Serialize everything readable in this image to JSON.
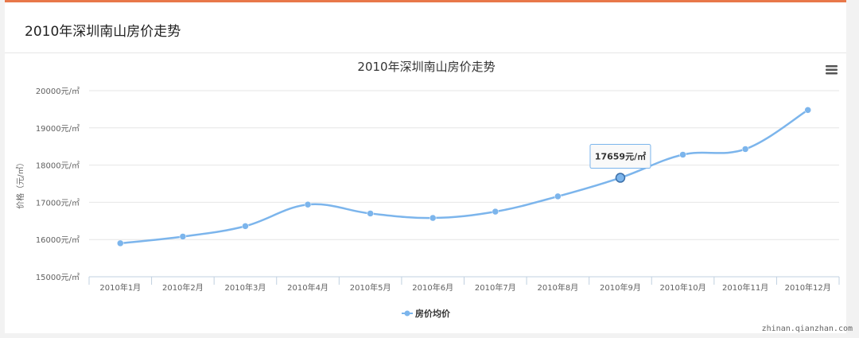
{
  "header": {
    "title": "2010年深圳南山房价走势"
  },
  "watermark": "zhinan.qianzhan.com",
  "menu": {
    "icon": "hamburger-menu-icon"
  },
  "colors": {
    "accent_border": "#e8784a",
    "series": "#7cb5ec",
    "point": "#7cb5ec"
  },
  "tooltip": {
    "text": "17659元/㎡",
    "category": "2010年9月"
  },
  "chart_data": {
    "type": "line",
    "title": "2010年深圳南山房价走势",
    "ylabel": "价格（元/㎡）",
    "xlabel": "",
    "categories": [
      "2010年1月",
      "2010年2月",
      "2010年3月",
      "2010年4月",
      "2010年5月",
      "2010年6月",
      "2010年7月",
      "2010年8月",
      "2010年9月",
      "2010年10月",
      "2010年11月",
      "2010年12月"
    ],
    "series": [
      {
        "name": "房价均价",
        "values": [
          15900,
          16080,
          16360,
          16940,
          16700,
          16580,
          16750,
          17160,
          17659,
          18280,
          18430,
          19480
        ]
      }
    ],
    "ylim": [
      15000,
      20000
    ],
    "yticks": [
      {
        "value": 15000,
        "label": "15000元/㎡"
      },
      {
        "value": 16000,
        "label": "16000元/㎡"
      },
      {
        "value": 17000,
        "label": "17000元/㎡"
      },
      {
        "value": 18000,
        "label": "18000元/㎡"
      },
      {
        "value": 19000,
        "label": "19000元/㎡"
      },
      {
        "value": 20000,
        "label": "20000元/㎡"
      }
    ],
    "grid": true,
    "legend": "bottom-center",
    "smooth": true
  }
}
